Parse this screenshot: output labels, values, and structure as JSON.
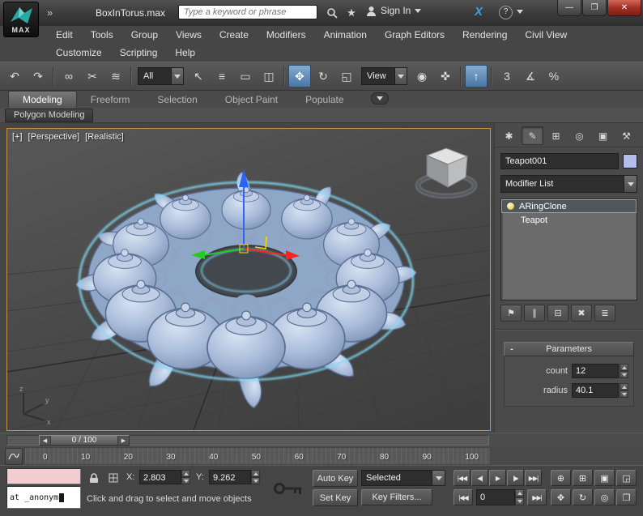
{
  "titlebar": {
    "logo_text": "MAX",
    "overflow": "»",
    "doc_title": "BoxInTorus.max",
    "search_placeholder": "Type a keyword or phrase",
    "star": "★",
    "sign_in": "Sign In",
    "exchange": "X",
    "help": "?",
    "min": "—",
    "restore": "❐",
    "close": "✕"
  },
  "menubar": {
    "row1": [
      "Edit",
      "Tools",
      "Group",
      "Views",
      "Create",
      "Modifiers",
      "Animation",
      "Graph Editors",
      "Rendering",
      "Civil View"
    ],
    "row2": [
      "Customize",
      "Scripting",
      "Help"
    ]
  },
  "toolbar": {
    "icons": [
      "↶",
      "↷",
      "∞",
      "✂",
      "≋",
      "↖",
      "≡",
      "▭",
      "◫",
      "✥",
      "↻",
      "◱",
      "◉",
      "✜",
      "↑",
      "3",
      "∡",
      "%"
    ],
    "filter_value": "All",
    "coord_value": "View"
  },
  "ribbon": {
    "tabs": [
      "Modeling",
      "Freeform",
      "Selection",
      "Object Paint",
      "Populate"
    ],
    "panel_label": "Polygon Modeling"
  },
  "viewport": {
    "label_menu": "[+]",
    "label_pov": "[Perspective]",
    "label_shading": "[Realistic]",
    "axis_x": "x",
    "axis_y": "y",
    "axis_z": "z"
  },
  "command_panel": {
    "tab_icons": [
      "✱",
      "✎",
      "⊞",
      "◎",
      "▣",
      "⚒"
    ],
    "object_name": "Teapot001",
    "modifier_list": "Modifier List",
    "stack_items": [
      "ARingClone",
      "Teapot"
    ],
    "stack_buttons": [
      "⚑",
      "∥",
      "⊟",
      "✖",
      "≣"
    ],
    "rollout": {
      "collapse": "-",
      "title": "Parameters",
      "count_label": "count",
      "count_value": "12",
      "radius_label": "radius",
      "radius_value": "40.1"
    }
  },
  "timeline": {
    "left_arrow": "◀",
    "right_arrow": "▶",
    "slider_value": "0 / 100",
    "ticks": [
      "0",
      "10",
      "20",
      "30",
      "40",
      "50",
      "60",
      "70",
      "80",
      "90",
      "100"
    ]
  },
  "statusbar": {
    "listener_text": "at _anonym",
    "prompt": "Click and drag to select and move objects",
    "x_label": "X:",
    "x_value": "2.803",
    "y_label": "Y:",
    "y_value": "9.262",
    "auto_key": "Auto Key",
    "set_key": "Set Key",
    "selection_set": "Selected",
    "key_filters": "Key Filters...",
    "frame_value": "0",
    "playback": [
      "|◀◀",
      "◀|",
      "▶",
      "|▶",
      "▶▶|"
    ],
    "prev_key": "|◀◀",
    "next_key": "▶▶|",
    "nav1": [
      "⊕",
      "⊞",
      "▣",
      "◲"
    ],
    "nav2": [
      "✥",
      "↻",
      "◎",
      "❒"
    ]
  }
}
